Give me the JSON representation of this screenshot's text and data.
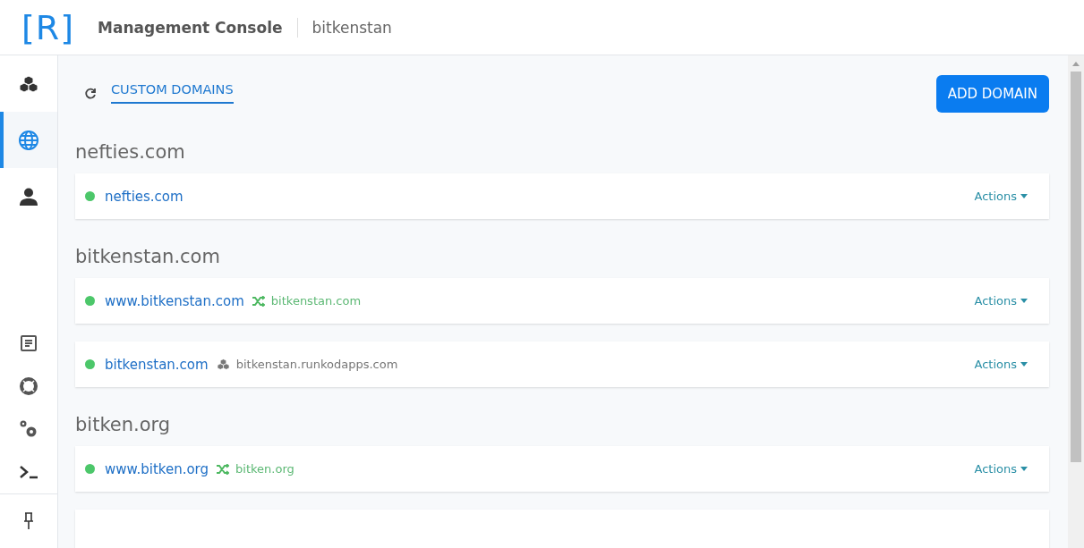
{
  "header": {
    "logo": "[R]",
    "title": "Management Console",
    "project": "bitkenstan"
  },
  "sidebar": {
    "top_items": [
      {
        "kind": "cubes",
        "selected": false
      },
      {
        "kind": "globe",
        "selected": true
      },
      {
        "kind": "user",
        "selected": false
      }
    ],
    "bottom_items": [
      {
        "kind": "document",
        "selected": false
      },
      {
        "kind": "lifebuoy",
        "selected": false
      },
      {
        "kind": "gears",
        "selected": false
      },
      {
        "kind": "terminal",
        "selected": false
      }
    ],
    "pin": {
      "kind": "pin"
    }
  },
  "toolbar": {
    "tab": "CUSTOM DOMAINS",
    "button": "ADD DOMAIN"
  },
  "groups": [
    {
      "title": "nefties.com",
      "domains": [
        {
          "name": "nefties.com",
          "color": "#4cc76a",
          "actions": "Actions"
        }
      ]
    },
    {
      "title": "bitkenstan.com",
      "domains": [
        {
          "name": "www.bitkenstan.com",
          "color": "#4cc76a",
          "target": {
            "kind": "redirect",
            "domain": "bitkenstan.com"
          },
          "actions": "Actions"
        },
        {
          "name": "bitkenstan.com",
          "color": "#4cc76a",
          "target": {
            "kind": "hosted",
            "domain": "bitkenstan.runkodapps.com"
          },
          "actions": "Actions"
        }
      ]
    },
    {
      "title": "bitken.org",
      "domains": [
        {
          "name": "www.bitken.org",
          "color": "#4cc76a",
          "target": {
            "kind": "redirect",
            "domain": "bitken.org"
          },
          "actions": "Actions"
        }
      ]
    }
  ]
}
